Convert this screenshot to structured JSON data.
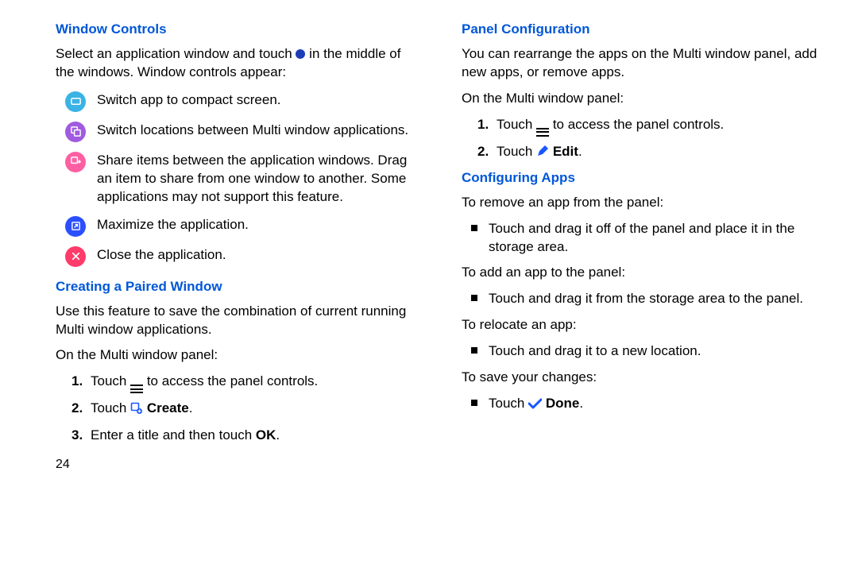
{
  "left": {
    "h1": "Window Controls",
    "intro_a": "Select an application window and touch ",
    "intro_b": " in the middle of the windows. Window controls appear:",
    "icons": [
      "Switch app to compact screen.",
      "Switch locations between Multi window applications.",
      "Share items between the application windows. Drag an item to share from one window to another. Some applications may not support this feature.",
      "Maximize the application.",
      "Close the application."
    ],
    "h2": "Creating a Paired Window",
    "p2": "Use this feature to save the combination of current running Multi window applications.",
    "p3": "On the Multi window panel:",
    "steps": {
      "s1a": "Touch ",
      "s1b": " to access the panel controls.",
      "s2a": "Touch ",
      "s2b": " Create",
      "s2c": ".",
      "s3a": "Enter a title and then touch ",
      "s3b": "OK",
      "s3c": "."
    },
    "pageNumber": "24"
  },
  "right": {
    "h1": "Panel Configuration",
    "p1": "You can rearrange the apps on the Multi window panel, add new apps, or remove apps.",
    "p2": "On the Multi window panel:",
    "steps": {
      "s1a": "Touch ",
      "s1b": " to access the panel controls.",
      "s2a": "Touch ",
      "s2b": " Edit",
      "s2c": "."
    },
    "h2": "Configuring Apps",
    "p3": "To remove an app from the panel:",
    "b1": "Touch and drag it off of the panel and place it in the storage area.",
    "p4": "To add an app to the panel:",
    "b2": "Touch and drag it from the storage area to the panel.",
    "p5": "To relocate an app:",
    "b3": "Touch and drag it to a new location.",
    "p6": "To save your changes:",
    "b4a": "Touch ",
    "b4b": " Done",
    "b4c": "."
  }
}
